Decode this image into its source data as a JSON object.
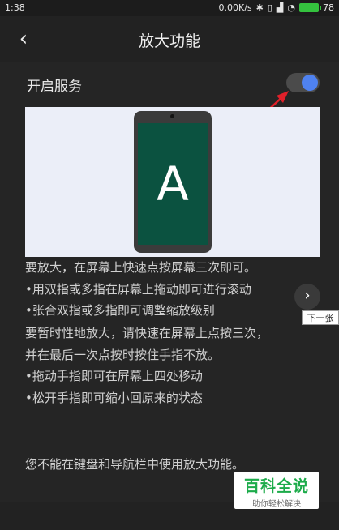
{
  "status_bar": {
    "time": "1:38",
    "network_speed": "0.00K/s",
    "battery": "78"
  },
  "header": {
    "title": "放大功能",
    "back_icon": "chevron-left-icon"
  },
  "service": {
    "label": "开启服务",
    "toggle_on": true,
    "accent_color": "#4f82f0"
  },
  "preview": {
    "letter": "A"
  },
  "instructions": {
    "p1": [
      "要放大，在屏幕上快速点按屏幕三次即可。",
      "•用双指或多指在屏幕上拖动即可进行滚动",
      "•张合双指或多指即可调整缩放级别"
    ],
    "p2": [
      "要暂时性地放大，请快速在屏幕上点按三次，",
      "并在最后一次点按时按住手指不放。",
      "•拖动手指即可在屏幕上四处移动",
      "•松开手指即可缩小回原来的状态"
    ],
    "p3": "您不能在键盘和导航栏中使用放大功能。"
  },
  "next": {
    "tooltip": "下一张"
  },
  "watermark": {
    "title": "百科全说",
    "subtitle": "助你轻松解决"
  }
}
